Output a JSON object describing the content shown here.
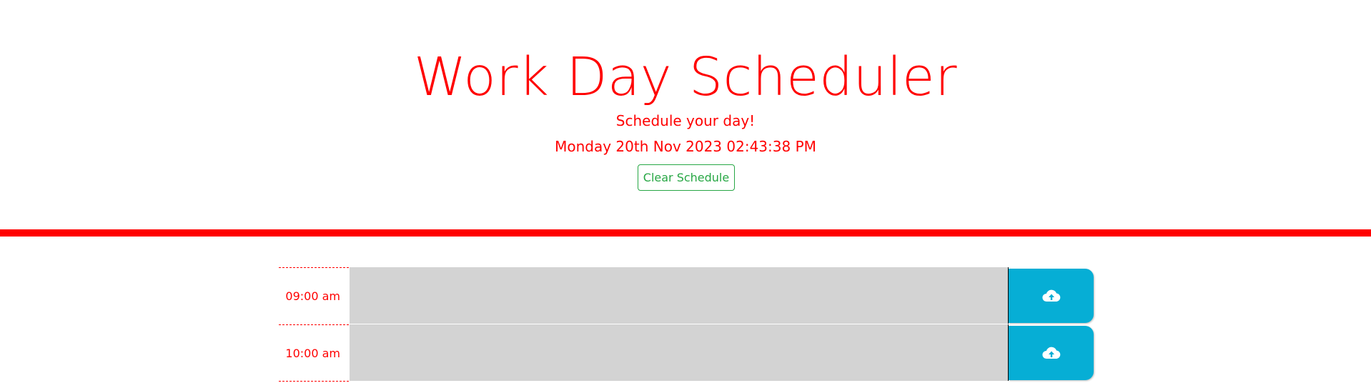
{
  "header": {
    "title": "Work Day Scheduler",
    "lead": "Schedule your day!",
    "current_day": "Monday 20th Nov 2023 02:43:38 PM",
    "clear_label": "Clear Schedule"
  },
  "rows": [
    {
      "hour": "09:00 am",
      "description": "",
      "icon": "cloud-upload-icon"
    },
    {
      "hour": "10:00 am",
      "description": "",
      "icon": "cloud-upload-icon"
    }
  ],
  "colors": {
    "accent": "#ff0000",
    "save_button": "#06aed5",
    "past_block": "#d3d3d3",
    "clear_button": "#28a745"
  }
}
